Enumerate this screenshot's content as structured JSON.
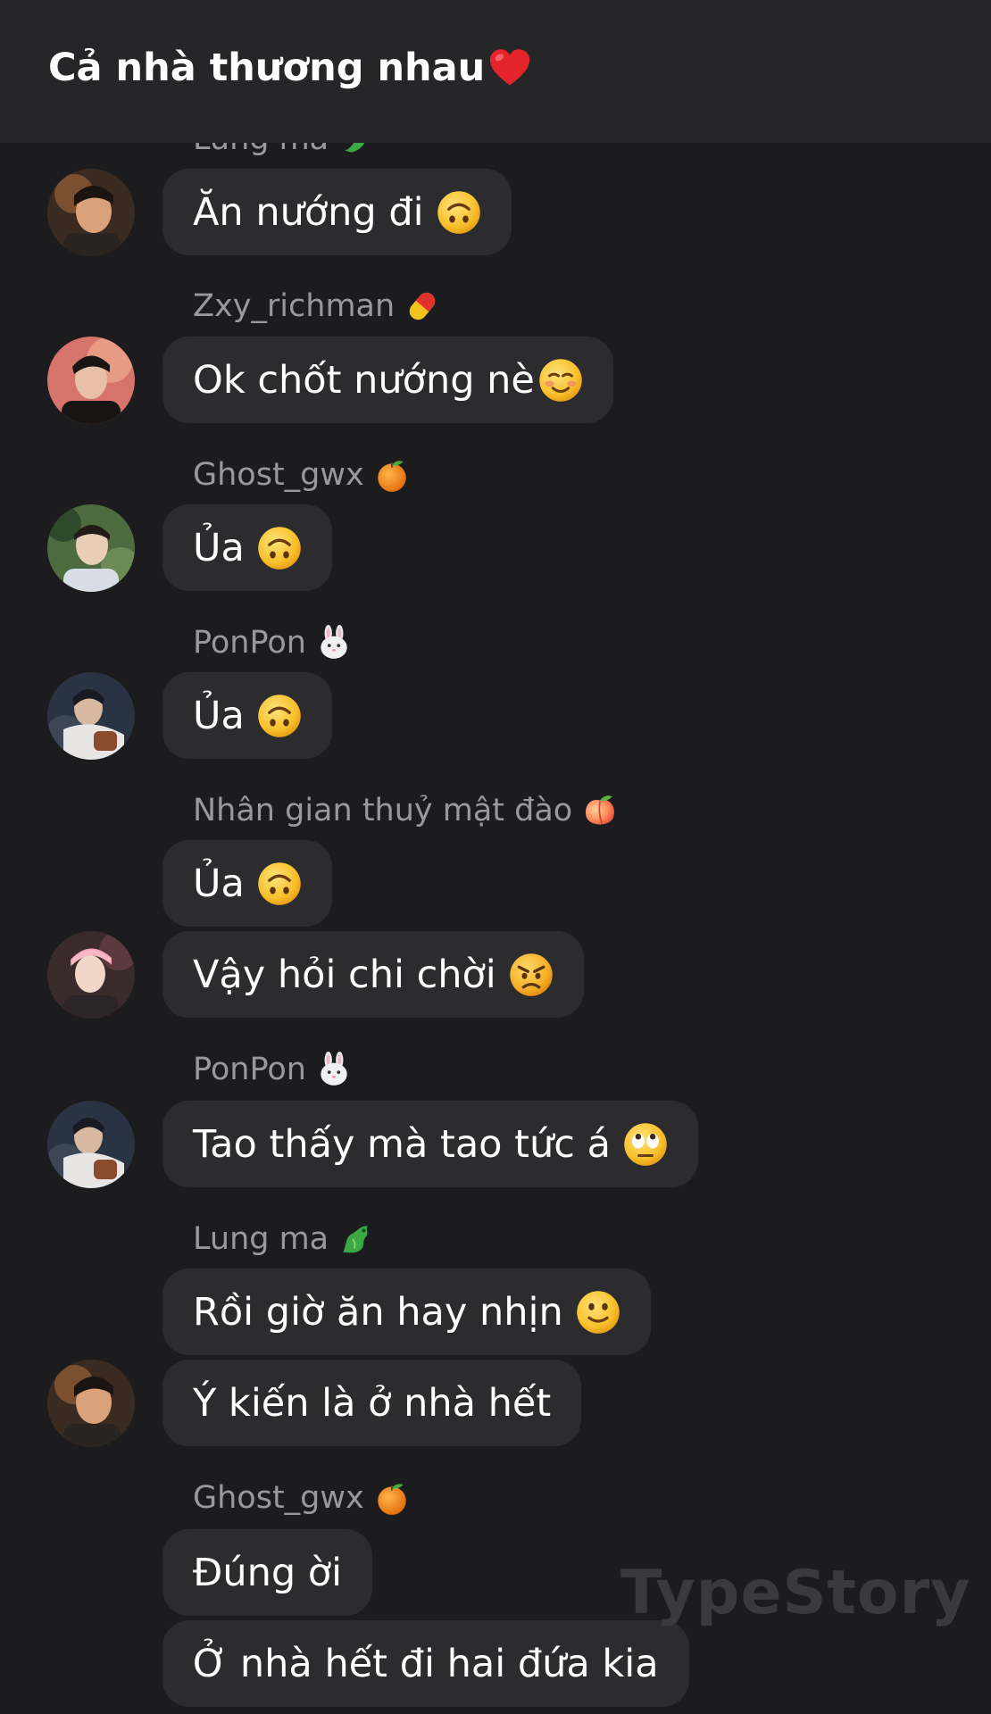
{
  "header": {
    "title": "Cả nhà thương nhau",
    "title_emoji": "red-heart"
  },
  "clipped_sender": {
    "name": "Lung ma",
    "emoji": "dragon"
  },
  "messages": [
    {
      "sender": null,
      "text": "Ăn nướng đi",
      "emoji": "upside-down-face"
    },
    {
      "sender": {
        "name": "Zxy_richman",
        "emoji": "pill"
      },
      "text": "Ok chốt nướng nè",
      "emoji": "smiling-face"
    },
    {
      "sender": {
        "name": "Ghost_gwx",
        "emoji": "tangerine"
      },
      "text": "Ủa",
      "emoji": "upside-down-face"
    },
    {
      "sender": {
        "name": "PonPon",
        "emoji": "rabbit-face"
      },
      "text": "Ủa",
      "emoji": "upside-down-face"
    },
    {
      "sender": {
        "name": "Nhân gian thuỷ mật đào",
        "emoji": "peach"
      },
      "text": "Ủa",
      "emoji": "upside-down-face"
    },
    {
      "sender": null,
      "text": "Vậy hỏi chi chời",
      "emoji": "angry-face"
    },
    {
      "sender": {
        "name": "PonPon",
        "emoji": "rabbit-face"
      },
      "text": "Tao thấy mà tao tức á",
      "emoji": "eye-roll-face"
    },
    {
      "sender": {
        "name": "Lung ma",
        "emoji": "dragon"
      },
      "text": "Rồi giờ ăn hay nhịn",
      "emoji": "slightly-smiling-face"
    },
    {
      "sender": null,
      "text": "Ý kiến là ở nhà hết",
      "emoji": null
    },
    {
      "sender": {
        "name": "Ghost_gwx",
        "emoji": "tangerine"
      },
      "text": "Đúng ời",
      "emoji": null
    },
    {
      "sender": null,
      "text": "Ở nhà hết đi hai đứa kia",
      "emoji": null
    }
  ],
  "watermark": "TypeStory",
  "colors": {
    "background": "#1c1c1e",
    "header": "#262628",
    "bubble": "#2c2c2e",
    "sender_name": "#98989d",
    "text": "#ffffff"
  }
}
